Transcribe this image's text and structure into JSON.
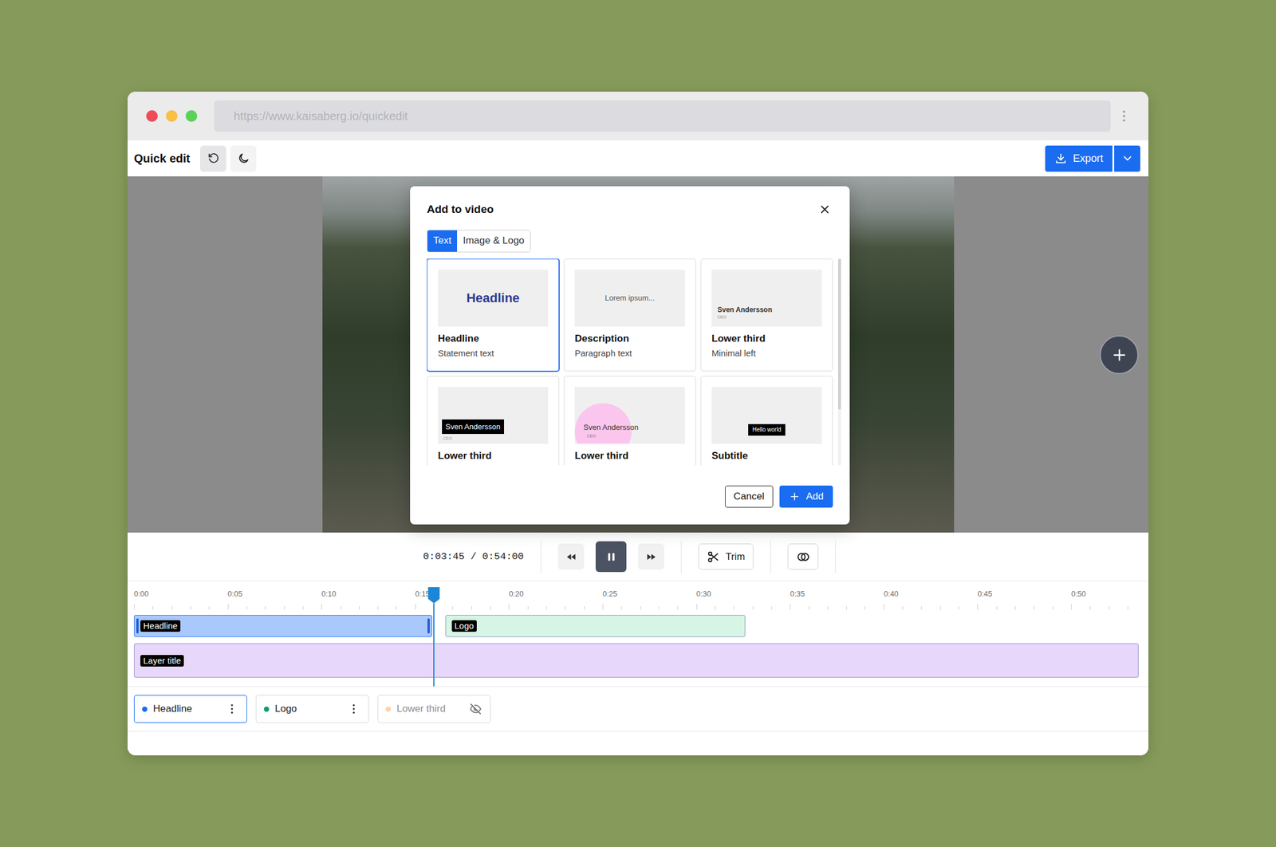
{
  "browser": {
    "url": "https://www.kaisaberg.io/quickedit"
  },
  "toolbar": {
    "title": "Quick edit",
    "export_label": "Export"
  },
  "dialog": {
    "title": "Add to video",
    "tabs": [
      {
        "label": "Text",
        "selected": true
      },
      {
        "label": "Image & Logo",
        "selected": false
      }
    ],
    "cards": [
      {
        "kind": "headline",
        "title": "Headline",
        "subtitle": "Statement text",
        "selected": true,
        "preview": {
          "text": "Headline"
        }
      },
      {
        "kind": "description",
        "title": "Description",
        "subtitle": "Paragraph text",
        "selected": false,
        "preview": {
          "text": "Lorem ipsum..."
        }
      },
      {
        "kind": "lower-third-minimal",
        "title": "Lower third",
        "subtitle": "Minimal left",
        "selected": false,
        "preview": {
          "name": "Sven Andersson",
          "role": "CEO"
        }
      },
      {
        "kind": "lower-third-box",
        "title": "Lower third",
        "selected": false,
        "preview": {
          "name": "Sven Andersson",
          "role": "CEO"
        }
      },
      {
        "kind": "lower-third-circle",
        "title": "Lower third",
        "selected": false,
        "preview": {
          "name": "Sven Andersson",
          "role": "CEO"
        }
      },
      {
        "kind": "subtitle",
        "title": "Subtitle",
        "selected": false,
        "preview": {
          "text": "Hello world"
        }
      }
    ],
    "buttons": {
      "cancel": "Cancel",
      "add": "Add"
    }
  },
  "playback": {
    "time": "0:03:45 / 0:54:00",
    "playing": true,
    "trim_label": "Trim"
  },
  "ruler": {
    "labels": [
      "0:00",
      "0:05",
      "0:10",
      "0:15",
      "0:20",
      "0:25",
      "0:30",
      "0:35",
      "0:40",
      "0:45",
      "0:50"
    ],
    "playhead_seconds": 16.0
  },
  "tracks": [
    {
      "clips": [
        {
          "label": "Headline",
          "start": 0,
          "end": 15.9,
          "color": "#a9c8fb",
          "selected": true
        },
        {
          "label": "Logo",
          "start": 16.6,
          "end": 32.6,
          "color": "#d6f5e4",
          "selected": false
        }
      ]
    },
    {
      "clips": [
        {
          "label": "Layer title",
          "start": 0,
          "end": 53.6,
          "color": "#e7d8fb",
          "selected": false
        }
      ]
    }
  ],
  "layers": [
    {
      "name": "Headline",
      "color": "#1a6cf0",
      "selected": true,
      "hidden": false
    },
    {
      "name": "Logo",
      "color": "#0f9d6a",
      "selected": false,
      "hidden": false
    },
    {
      "name": "Lower third",
      "color": "#fbd3a6",
      "selected": false,
      "hidden": true
    }
  ]
}
